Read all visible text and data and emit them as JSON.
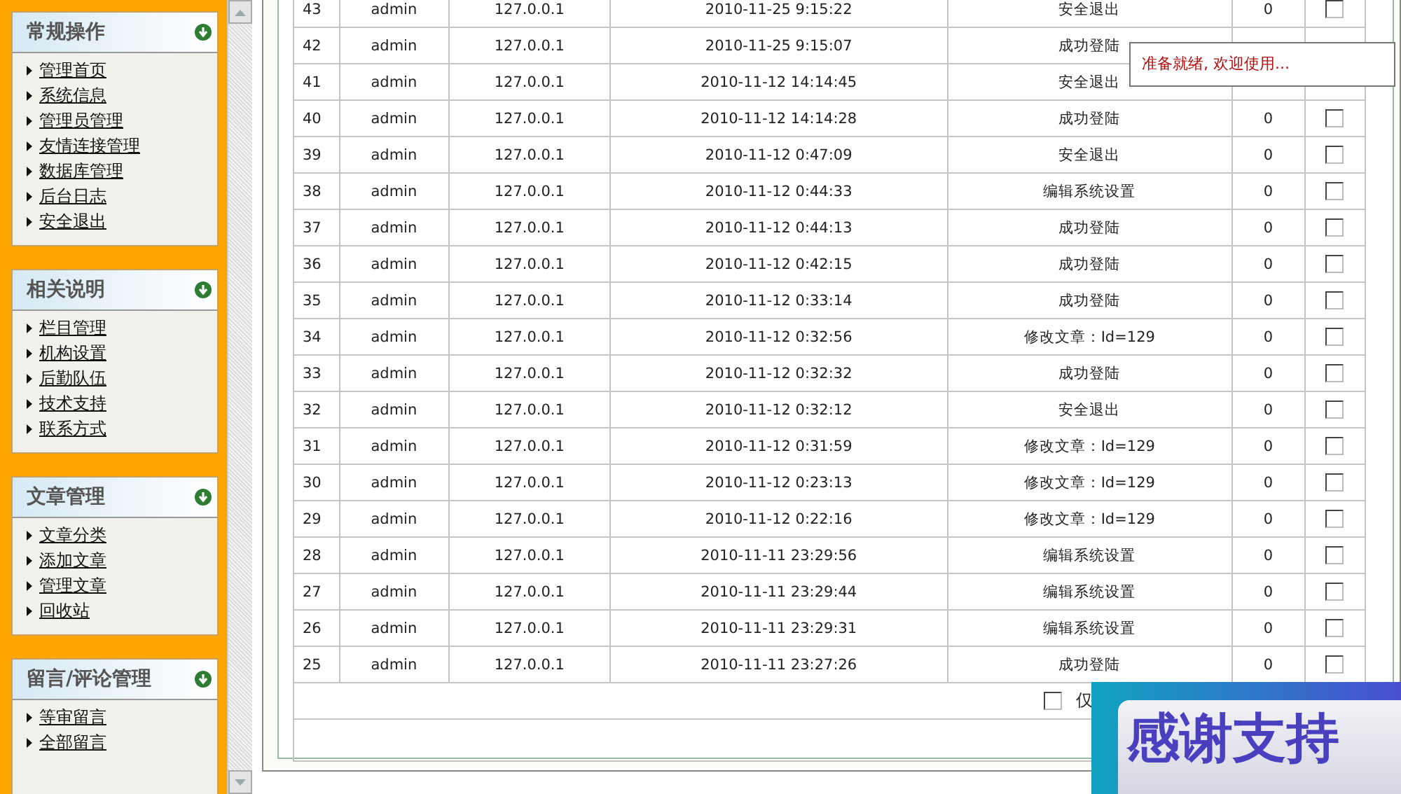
{
  "sidebar": {
    "panels": [
      {
        "title": "常规操作",
        "items": [
          "管理首页",
          "系统信息",
          "管理员管理",
          "友情连接管理",
          "数据库管理",
          "后台日志",
          "安全退出"
        ]
      },
      {
        "title": "相关说明",
        "items": [
          "栏目管理",
          "机构设置",
          "后勤队伍",
          "技术支持",
          "联系方式"
        ]
      },
      {
        "title": "文章管理",
        "items": [
          "文章分类",
          "添加文章",
          "管理文章",
          "回收站"
        ]
      },
      {
        "title": "留言/评论管理",
        "items": [
          "等审留言",
          "全部留言"
        ]
      }
    ]
  },
  "log_table": {
    "rows": [
      {
        "id": "43",
        "user": "admin",
        "ip": "127.0.0.1",
        "time": "2010-11-25 9:15:22",
        "action": "安全退出",
        "count": "0",
        "checked": false
      },
      {
        "id": "42",
        "user": "admin",
        "ip": "127.0.0.1",
        "time": "2010-11-25 9:15:07",
        "action": "成功登陆"
      },
      {
        "id": "41",
        "user": "admin",
        "ip": "127.0.0.1",
        "time": "2010-11-12 14:14:45",
        "action": "安全退出"
      },
      {
        "id": "40",
        "user": "admin",
        "ip": "127.0.0.1",
        "time": "2010-11-12 14:14:28",
        "action": "成功登陆",
        "count": "0",
        "checked": false
      },
      {
        "id": "39",
        "user": "admin",
        "ip": "127.0.0.1",
        "time": "2010-11-12 0:47:09",
        "action": "安全退出",
        "count": "0",
        "checked": false
      },
      {
        "id": "38",
        "user": "admin",
        "ip": "127.0.0.1",
        "time": "2010-11-12 0:44:33",
        "action": "编辑系统设置",
        "count": "0",
        "checked": false
      },
      {
        "id": "37",
        "user": "admin",
        "ip": "127.0.0.1",
        "time": "2010-11-12 0:44:13",
        "action": "成功登陆",
        "count": "0",
        "checked": false
      },
      {
        "id": "36",
        "user": "admin",
        "ip": "127.0.0.1",
        "time": "2010-11-12 0:42:15",
        "action": "成功登陆",
        "count": "0",
        "checked": false
      },
      {
        "id": "35",
        "user": "admin",
        "ip": "127.0.0.1",
        "time": "2010-11-12 0:33:14",
        "action": "成功登陆",
        "count": "0",
        "checked": false
      },
      {
        "id": "34",
        "user": "admin",
        "ip": "127.0.0.1",
        "time": "2010-11-12 0:32:56",
        "action": "修改文章：Id=129",
        "count": "0",
        "checked": false
      },
      {
        "id": "33",
        "user": "admin",
        "ip": "127.0.0.1",
        "time": "2010-11-12 0:32:32",
        "action": "成功登陆",
        "count": "0",
        "checked": false
      },
      {
        "id": "32",
        "user": "admin",
        "ip": "127.0.0.1",
        "time": "2010-11-12 0:32:12",
        "action": "安全退出",
        "count": "0",
        "checked": false
      },
      {
        "id": "31",
        "user": "admin",
        "ip": "127.0.0.1",
        "time": "2010-11-12 0:31:59",
        "action": "修改文章：Id=129",
        "count": "0",
        "checked": false
      },
      {
        "id": "30",
        "user": "admin",
        "ip": "127.0.0.1",
        "time": "2010-11-12 0:23:13",
        "action": "修改文章：Id=129",
        "count": "0",
        "checked": false
      },
      {
        "id": "29",
        "user": "admin",
        "ip": "127.0.0.1",
        "time": "2010-11-12 0:22:16",
        "action": "修改文章：Id=129",
        "count": "0",
        "checked": false
      },
      {
        "id": "28",
        "user": "admin",
        "ip": "127.0.0.1",
        "time": "2010-11-11 23:29:56",
        "action": "编辑系统设置",
        "count": "0",
        "checked": false
      },
      {
        "id": "27",
        "user": "admin",
        "ip": "127.0.0.1",
        "time": "2010-11-11 23:29:44",
        "action": "编辑系统设置",
        "count": "0",
        "checked": false
      },
      {
        "id": "26",
        "user": "admin",
        "ip": "127.0.0.1",
        "time": "2010-11-11 23:29:31",
        "action": "编辑系统设置",
        "count": "0",
        "checked": false
      },
      {
        "id": "25",
        "user": "admin",
        "ip": "127.0.0.1",
        "time": "2010-11-11 23:27:26",
        "action": "成功登陆",
        "count": "0",
        "checked": false
      }
    ],
    "footer": {
      "checkbox": {
        "label": "仅",
        "checked": false
      }
    }
  },
  "status_tooltip": {
    "text": "准备就绪, 欢迎使用..."
  },
  "promo_badge": {
    "text": "感谢支持"
  }
}
